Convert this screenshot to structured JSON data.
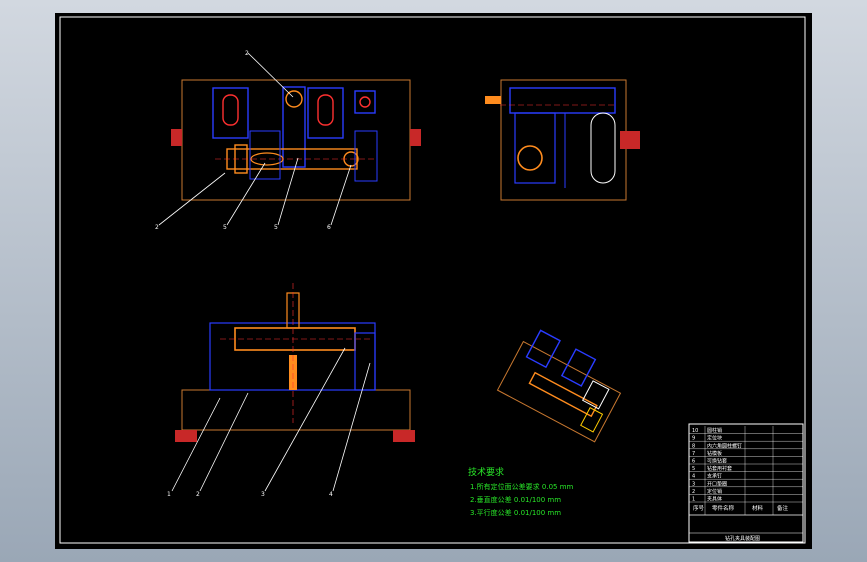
{
  "drawing": {
    "tech_title": "技术要求",
    "tech_notes": [
      "1.所有定位面公差要求 0.05 mm",
      "2.垂直度公差 0.01/100 mm",
      "3.平行度公差 0.01/100 mm"
    ],
    "balloons": {
      "top": [
        "2",
        "2",
        "5",
        "5",
        "6"
      ],
      "front": [
        "1",
        "2",
        "3",
        "4"
      ]
    },
    "title_block": {
      "rows": [
        {
          "no": "10",
          "name": "圆柱销"
        },
        {
          "no": "9",
          "name": "定位块"
        },
        {
          "no": "8",
          "name": "内六角圆柱螺钉"
        },
        {
          "no": "7",
          "name": "钻模板"
        },
        {
          "no": "6",
          "name": "可换钻套"
        },
        {
          "no": "5",
          "name": "钻套用衬套"
        },
        {
          "no": "4",
          "name": "支承钉"
        },
        {
          "no": "3",
          "name": "开口垫圈"
        },
        {
          "no": "2",
          "name": "定位销"
        },
        {
          "no": "1",
          "name": "夹具体"
        }
      ],
      "header": [
        "序号",
        "零件名称",
        "材料",
        "备注"
      ],
      "bottom_label": "钻孔夹具装配图"
    }
  },
  "colors": {
    "frame": "#ffffff",
    "outline": "#c87830",
    "blue": "#2a3cff",
    "part": "#ff8c1e",
    "red": "#c82828",
    "green": "#28e628"
  }
}
